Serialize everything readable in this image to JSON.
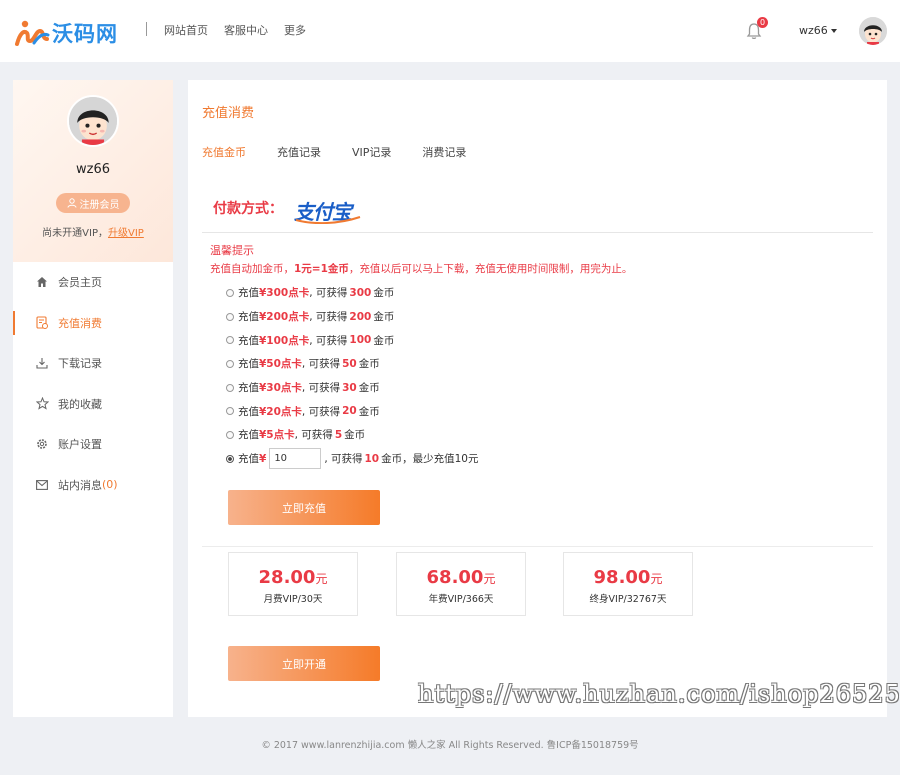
{
  "header": {
    "logo_text": "沃码网",
    "nav": [
      "网站首页",
      "客服中心",
      "更多"
    ],
    "notification_count": "0",
    "username": "wz66"
  },
  "sidebar": {
    "username": "wz66",
    "register_label": "注册会员",
    "vip_status": "尚未开通VIP，",
    "upgrade_label": "升级VIP",
    "items": [
      {
        "label": "会员主页",
        "icon": "home-icon"
      },
      {
        "label": "充值消费",
        "icon": "invoice-icon"
      },
      {
        "label": "下载记录",
        "icon": "download-icon"
      },
      {
        "label": "我的收藏",
        "icon": "star-icon"
      },
      {
        "label": "账户设置",
        "icon": "gear-icon"
      },
      {
        "label": "站内消息",
        "icon": "mail-icon"
      }
    ],
    "message_count": "(0)"
  },
  "main": {
    "title": "充值消费",
    "tabs": [
      "充值金币",
      "充值记录",
      "VIP记录",
      "消费记录"
    ],
    "pay_label": "付款方式：",
    "alipay_text": "支付宝",
    "tips_title": "温馨提示",
    "tips_pre": "充值自动加金币，",
    "tips_rate": "1元=1金币",
    "tips_post": "，充值以后可以马上下载，充值无使用时间限制，用完为止。",
    "options": [
      {
        "prefix": "充值 ",
        "price": "¥300点卡",
        "mid": ", 可获得 ",
        "amount": "300",
        "suffix": " 金币"
      },
      {
        "prefix": "充值 ",
        "price": "¥200点卡",
        "mid": ", 可获得 ",
        "amount": "200",
        "suffix": " 金币"
      },
      {
        "prefix": "充值 ",
        "price": "¥100点卡",
        "mid": ", 可获得 ",
        "amount": "100",
        "suffix": " 金币"
      },
      {
        "prefix": "充值 ",
        "price": "¥50点卡",
        "mid": ", 可获得 ",
        "amount": "50",
        "suffix": " 金币"
      },
      {
        "prefix": "充值 ",
        "price": "¥30点卡",
        "mid": ", 可获得 ",
        "amount": "30",
        "suffix": " 金币"
      },
      {
        "prefix": "充值 ",
        "price": "¥20点卡",
        "mid": ", 可获得 ",
        "amount": "20",
        "suffix": " 金币"
      },
      {
        "prefix": "充值 ",
        "price": "¥5点卡",
        "mid": ", 可获得 ",
        "amount": "5",
        "suffix": " 金币"
      }
    ],
    "custom": {
      "prefix": "充值 ",
      "currency": "¥",
      "value": "10",
      "mid": ", 可获得 ",
      "amount": "10",
      "suffix": " 金币，最少充值10元"
    },
    "recharge_button": "立即充值",
    "vip_plans": [
      {
        "price": "28.00",
        "unit": "元",
        "desc": "月费VIP/30天"
      },
      {
        "price": "68.00",
        "unit": "元",
        "desc": "年费VIP/366天"
      },
      {
        "price": "98.00",
        "unit": "元",
        "desc": "终身VIP/32767天"
      }
    ],
    "open_button": "立即开通"
  },
  "watermark": "https://www.huzhan.com/ishop26525",
  "footer": "© 2017 www.lanrenzhijia.com 懒人之家 All Rights Reserved. 鲁ICP备15018759号",
  "colors": {
    "accent": "#f07a31",
    "red": "#e93a45",
    "logo_blue": "#2b8ee5"
  }
}
